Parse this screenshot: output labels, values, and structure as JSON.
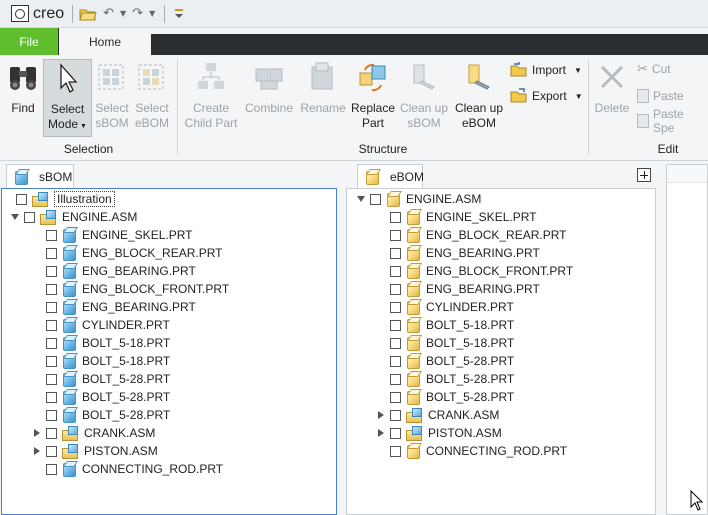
{
  "app": {
    "name": "creo"
  },
  "tabs": {
    "file": "File",
    "home": "Home"
  },
  "ribbon": {
    "find": "Find",
    "select_mode_1": "Select",
    "select_mode_2": "Mode",
    "select_sbom_1": "Select",
    "select_sbom_2": "sBOM",
    "select_ebom_1": "Select",
    "select_ebom_2": "eBOM",
    "create_child_1": "Create",
    "create_child_2": "Child Part",
    "combine": "Combine",
    "rename": "Rename",
    "replace_part_1": "Replace",
    "replace_part_2": "Part",
    "cleanup_sbom_1": "Clean up",
    "cleanup_sbom_2": "sBOM",
    "cleanup_ebom_1": "Clean up",
    "cleanup_ebom_2": "eBOM",
    "import": "Import",
    "export": "Export",
    "delete": "Delete",
    "cut": "Cut",
    "paste": "Paste",
    "paste_special": "Paste Spe",
    "group_selection": "Selection",
    "group_structure": "Structure",
    "group_edit": "Edit"
  },
  "sbom": {
    "tab": "sBOM",
    "illustration": "Illustration",
    "root": "ENGINE.ASM",
    "items": [
      "ENGINE_SKEL.PRT",
      "ENG_BLOCK_REAR.PRT",
      "ENG_BEARING.PRT",
      "ENG_BLOCK_FRONT.PRT",
      "ENG_BEARING.PRT",
      "CYLINDER.PRT",
      "BOLT_5-18.PRT",
      "BOLT_5-18.PRT",
      "BOLT_5-28.PRT",
      "BOLT_5-28.PRT",
      "BOLT_5-28.PRT",
      "CRANK.ASM",
      "PISTON.ASM",
      "CONNECTING_ROD.PRT"
    ]
  },
  "ebom": {
    "tab": "eBOM",
    "root": "ENGINE.ASM",
    "items": [
      "ENGINE_SKEL.PRT",
      "ENG_BLOCK_REAR.PRT",
      "ENG_BEARING.PRT",
      "ENG_BLOCK_FRONT.PRT",
      "ENG_BEARING.PRT",
      "CYLINDER.PRT",
      "BOLT_5-18.PRT",
      "BOLT_5-18.PRT",
      "BOLT_5-28.PRT",
      "BOLT_5-28.PRT",
      "BOLT_5-28.PRT",
      "CRANK.ASM",
      "PISTON.ASM",
      "CONNECTING_ROD.PRT"
    ]
  },
  "colors": {
    "file_tab": "#5fbd2e",
    "tab_bar": "#2a2e31",
    "ribbon_bg": "#f4f5f6",
    "select_blue": "#2f6fbf"
  }
}
